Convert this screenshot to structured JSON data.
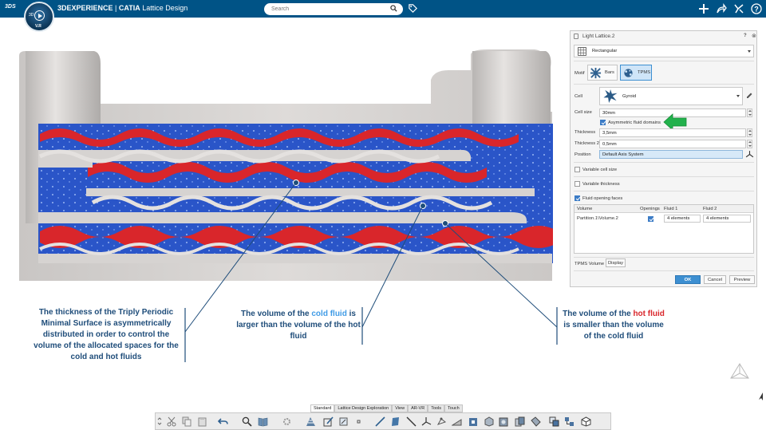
{
  "app": {
    "logo": "3DS",
    "compass_label": "3D",
    "compass_version": "V.R",
    "title_brand": "3DEXPERIENCE",
    "title_separator": " | ",
    "title_app": "CATIA",
    "title_module": "Lattice Design"
  },
  "search": {
    "placeholder": "Search"
  },
  "header_icons": [
    "search-icon",
    "tag-icon",
    "plus-icon",
    "share-icon",
    "tools-icon",
    "help-icon"
  ],
  "callouts": {
    "left": "The thickness of the Triply Periodic Minimal Surface is asymmetrically distributed in order to control the volume of the allocated spaces for the cold and hot fluids",
    "middle": {
      "pre": "The volume of the ",
      "highlight": "cold fluid",
      "post": " is larger than the volume of the hot fluid",
      "highlight_color": "#3f9be6"
    },
    "right": {
      "pre": "The volume of the ",
      "highlight": "hot fluid",
      "post": " is smaller than the volume of the cold fluid",
      "highlight_color": "#d9262b"
    }
  },
  "panel": {
    "title": "Light Lattice.2",
    "help": "?",
    "close": "⊗",
    "lattice_type": "Rectangular",
    "motif_label": "Motif",
    "motif_options": [
      "Bars",
      "TPMS"
    ],
    "motif_selected": "TPMS",
    "cell_label": "Cell",
    "cell_value": "Gyroid",
    "cell_size_label": "Cell size",
    "cell_size_value": "30mm",
    "asym_label": "Asymmetric fluid domains",
    "asym_checked": true,
    "thickness_label": "Thickness",
    "thickness_value": "3,5mm",
    "thickness2_label": "Thickness 2",
    "thickness2_value": "0,5mm",
    "position_label": "Position",
    "position_value": "Default Axis System",
    "variable_cell_size": "Variable cell size",
    "variable_thickness": "Variable thickness",
    "fluid_opening_faces": "Fluid opening faces",
    "fluid_opening_checked": true,
    "table": {
      "headers": [
        "Volume",
        "Openings",
        "Fluid 1",
        "Fluid 2"
      ],
      "rows": [
        {
          "volume": "Partition.1\\Volume.2",
          "openings": true,
          "fluid1": "4 elements",
          "fluid2": "4 elements"
        }
      ]
    },
    "tpms_volume_label": "TPMS Volume",
    "display_button": "Display",
    "ok": "OK",
    "cancel": "Cancel",
    "preview": "Preview"
  },
  "bottom_tabs": [
    "Standard",
    "Lattice Design Exploration",
    "View",
    "AR-VR",
    "Tools",
    "Touch"
  ],
  "colors": {
    "header": "#005386",
    "hot_fluid": "#d9262b",
    "cold_fluid": "#2f5fcf",
    "callout_text": "#1f4d7a",
    "arrow": "#22b14c"
  }
}
